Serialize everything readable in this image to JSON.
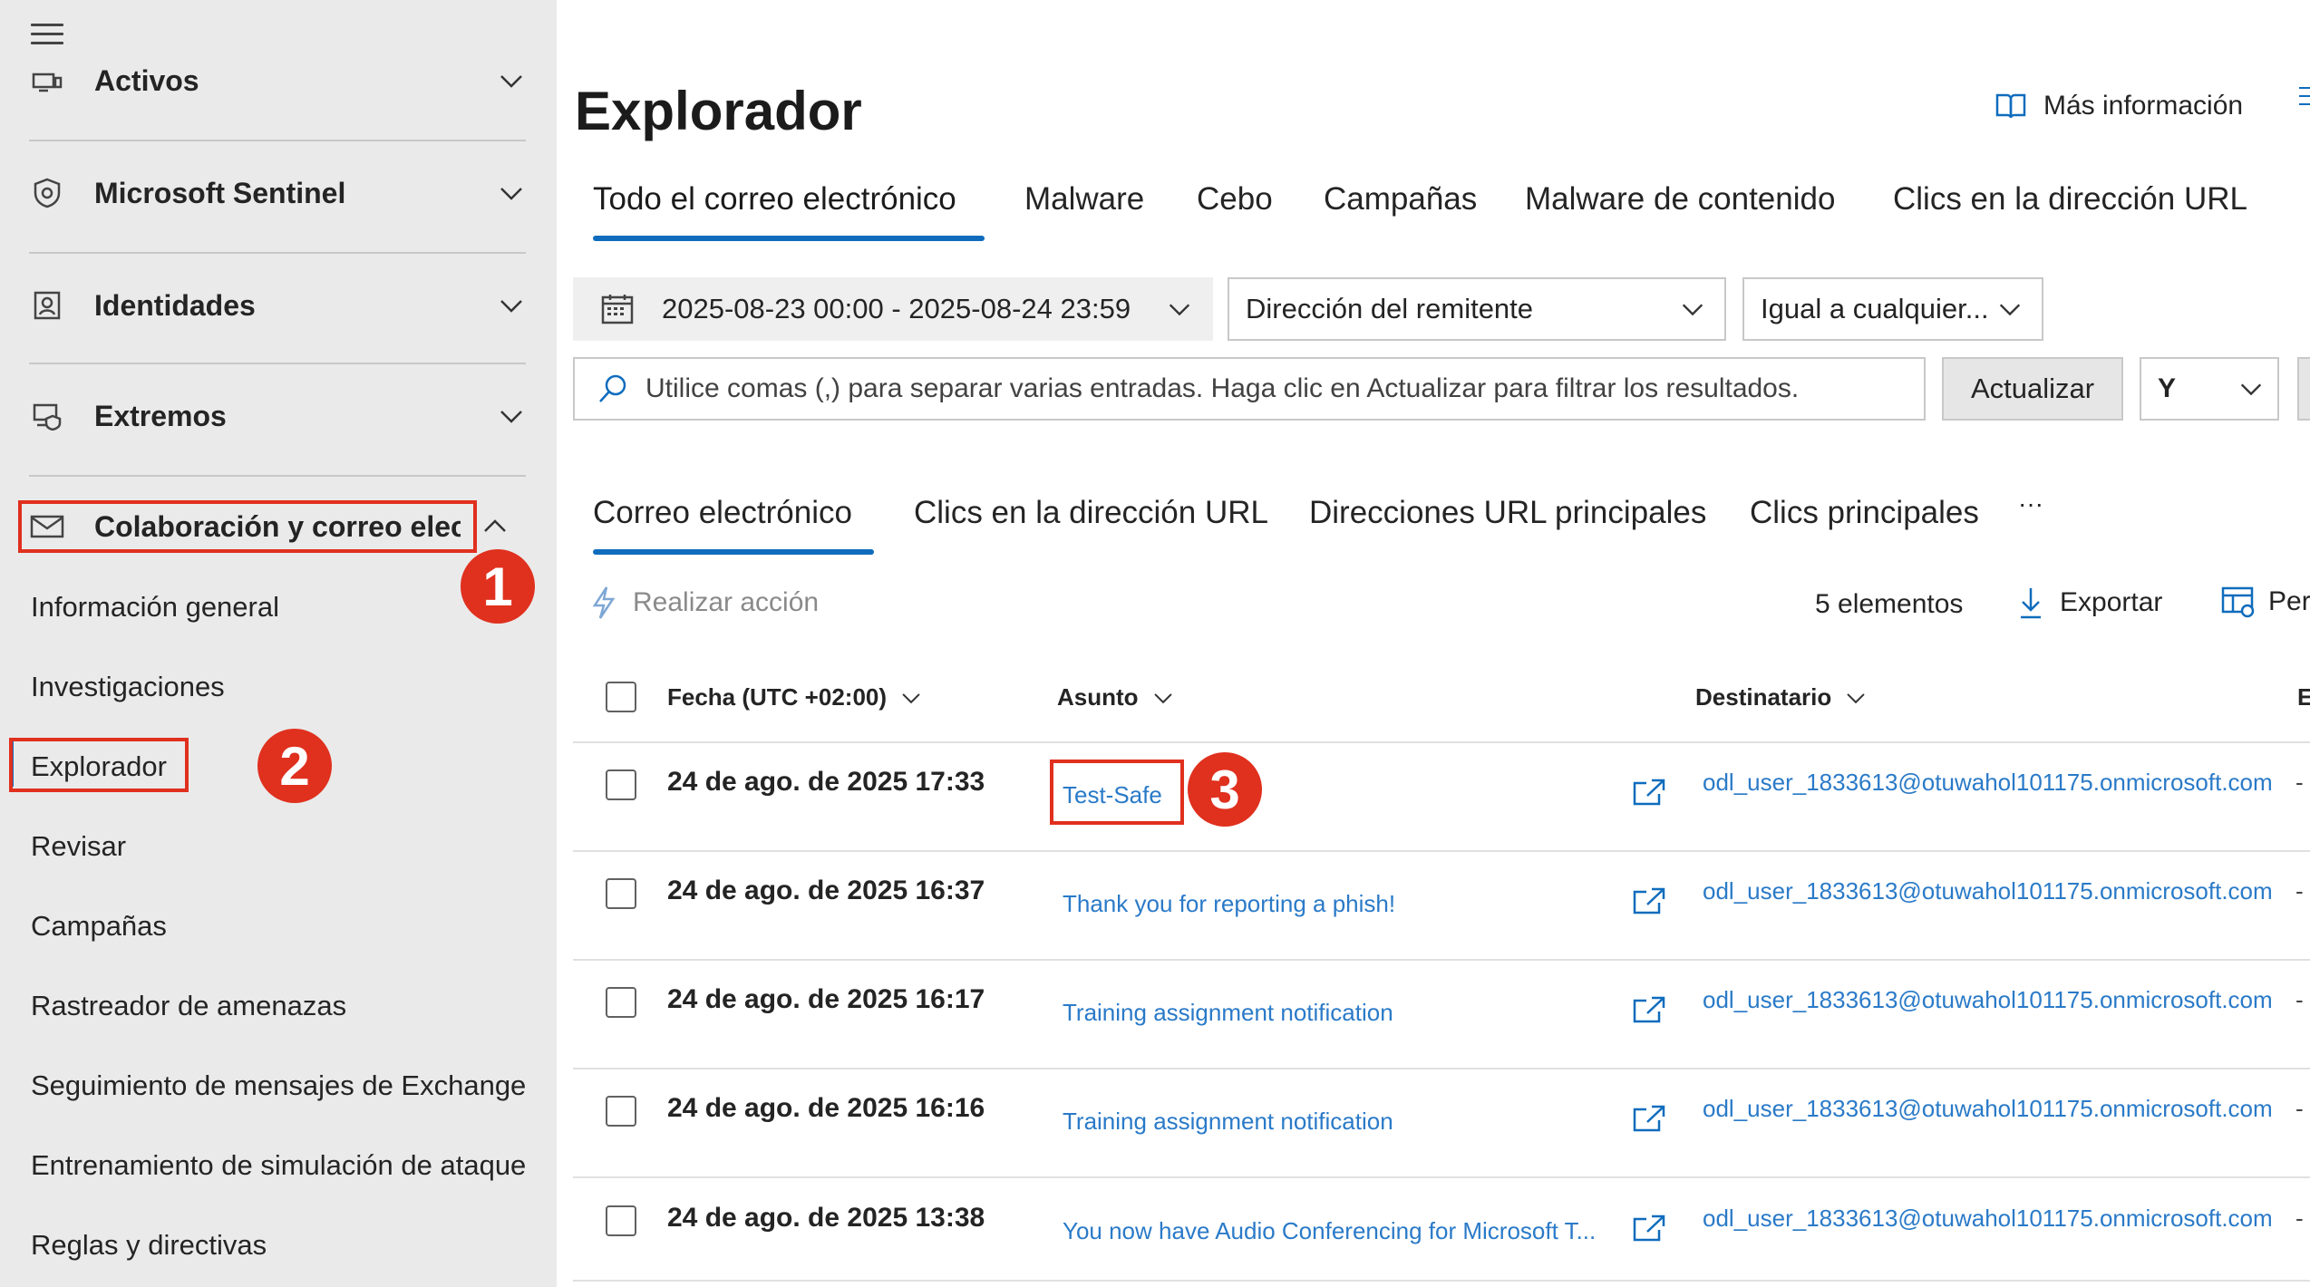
{
  "sidebar": {
    "groups": [
      {
        "label": "Activos",
        "icon": "devices-icon"
      },
      {
        "label": "Microsoft Sentinel",
        "icon": "shield-eye-icon"
      },
      {
        "label": "Identidades",
        "icon": "identity-card-icon"
      },
      {
        "label": "Extremos",
        "icon": "endpoint-icon"
      },
      {
        "label": "Colaboración y correo electrónico",
        "icon": "mail-icon"
      }
    ],
    "sub_items": [
      "Información general",
      "Investigaciones",
      "Explorador",
      "Revisar",
      "Campañas",
      "Rastreador de amenazas",
      "Seguimiento de mensajes de Exchange",
      "Entrenamiento de simulación de ataque",
      "Reglas y directivas"
    ],
    "active_item": "Explorador"
  },
  "callouts": {
    "one": "1",
    "two": "2",
    "three": "3"
  },
  "header": {
    "title": "Explorador",
    "more_info": "Más información"
  },
  "main_tabs": [
    "Todo el correo electrónico",
    "Malware",
    "Cebo",
    "Campañas",
    "Malware de contenido",
    "Clics en la dirección URL"
  ],
  "filters": {
    "date_range": "2025-08-23 00:00 - 2025-08-24 23:59",
    "field": "Dirección del remitente",
    "operator": "Igual a cualquier...",
    "search_placeholder": "Utilice comas (,) para separar varias entradas. Haga clic en Actualizar para filtrar los resultados.",
    "update_button": "Actualizar",
    "logic": "Y"
  },
  "sub_tabs": [
    "Correo electrónico",
    "Clics en la dirección URL",
    "Direcciones URL principales",
    "Clics principales"
  ],
  "more_tabs": "···",
  "toolbar": {
    "action": "Realizar acción",
    "count": "5 elementos",
    "export": "Exportar",
    "customize": "Per"
  },
  "table": {
    "columns": [
      "Fecha (UTC +02:00)",
      "Asunto",
      "Destinatario",
      "E"
    ],
    "rows": [
      {
        "date": "24 de ago. de 2025 17:33",
        "subject": "Test-Safe",
        "recipient": "odl_user_1833613@otuwahol101175.onmicrosoft.com",
        "extra": "-"
      },
      {
        "date": "24 de ago. de 2025 16:37",
        "subject": "Thank you for reporting a phish!",
        "recipient": "odl_user_1833613@otuwahol101175.onmicrosoft.com",
        "extra": "-"
      },
      {
        "date": "24 de ago. de 2025 16:17",
        "subject": "Training assignment notification",
        "recipient": "odl_user_1833613@otuwahol101175.onmicrosoft.com",
        "extra": "-"
      },
      {
        "date": "24 de ago. de 2025 16:16",
        "subject": "Training assignment notification",
        "recipient": "odl_user_1833613@otuwahol101175.onmicrosoft.com",
        "extra": "-"
      },
      {
        "date": "24 de ago. de 2025 13:38",
        "subject": "You now have Audio Conferencing for Microsoft T...",
        "recipient": "odl_user_1833613@otuwahol101175.onmicrosoft.com",
        "extra": "-"
      }
    ]
  },
  "colors": {
    "accent": "#0f6cbd",
    "link": "#2a7ac8",
    "callout": "#e0301e",
    "sidebar_bg": "#eaeaea"
  }
}
